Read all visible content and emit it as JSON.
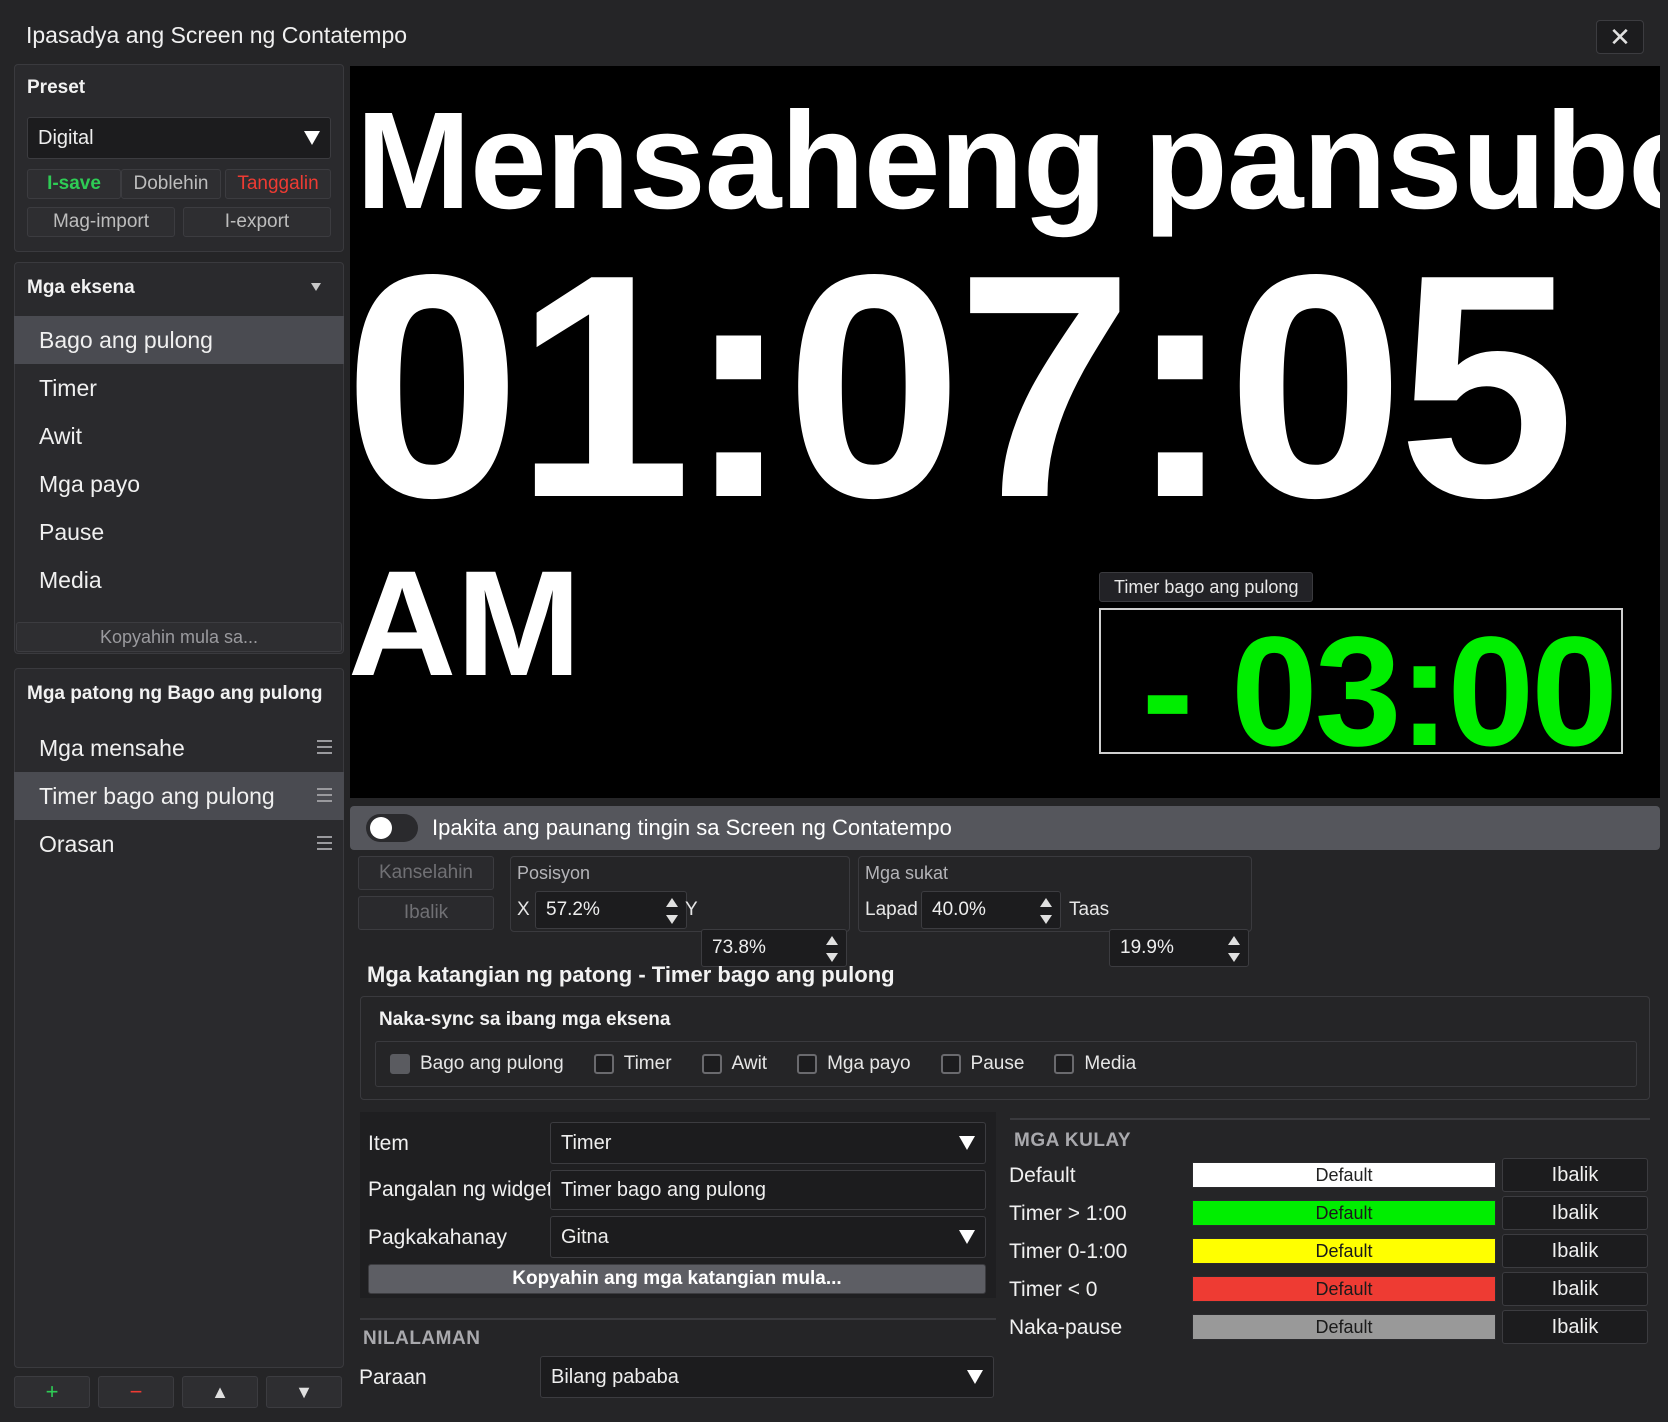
{
  "window": {
    "title": "Ipasadya ang Screen ng Contatempo"
  },
  "preset": {
    "header": "Preset",
    "selected": "Digital",
    "buttons": {
      "save": "I-save",
      "duplicate": "Doblehin",
      "delete": "Tanggalin",
      "import": "Mag-import",
      "export": "I-export"
    }
  },
  "scenes": {
    "header": "Mga eksena",
    "items": [
      "Bago ang pulong",
      "Timer",
      "Awit",
      "Mga payo",
      "Pause",
      "Media"
    ],
    "selected_index": 0,
    "copy_from": "Kopyahin mula sa..."
  },
  "layers": {
    "header": "Mga patong ng Bago ang pulong",
    "items": [
      "Mga mensahe",
      "Timer bago ang pulong",
      "Orasan"
    ],
    "selected_index": 1
  },
  "bottom_toolbar": {
    "add": "+",
    "remove": "−",
    "up": "▲",
    "down": "▼"
  },
  "preview": {
    "message": "Mensaheng pansubok",
    "clock": "01:07:05",
    "ampm": "AM",
    "timer_label": "Timer bago ang pulong",
    "timer_value": "- 03:00",
    "timer_color": "#00ee00"
  },
  "preview_toggle": {
    "label": "Ipakita ang paunang tingin sa Screen ng Contatempo",
    "enabled": false
  },
  "geometry_controls": {
    "cancel": "Kanselahin",
    "reset": "Ibalik",
    "position": {
      "label": "Posisyon",
      "x_label": "X",
      "x_value": "57.2%",
      "y_label": "Y",
      "y_value": "73.8%"
    },
    "size": {
      "label": "Mga sukat",
      "width_label": "Lapad",
      "width_value": "40.0%",
      "height_label": "Taas",
      "height_value": "19.9%"
    }
  },
  "properties": {
    "title": "Mga katangian ng patong - Timer bago ang pulong",
    "sync": {
      "title": "Naka-sync sa ibang mga eksena",
      "scenes": [
        "Bago ang pulong",
        "Timer",
        "Awit",
        "Mga payo",
        "Pause",
        "Media"
      ]
    },
    "item": {
      "label": "Item",
      "value": "Timer"
    },
    "widget_name": {
      "label": "Pangalan ng widget",
      "value": "Timer bago ang pulong"
    },
    "alignment": {
      "label": "Pagkakahanay",
      "value": "Gitna"
    },
    "copy_props": "Kopyahin ang mga katangian mula..."
  },
  "content": {
    "title": "NILALAMAN",
    "mode_label": "Paraan",
    "mode_value": "Bilang pababa"
  },
  "colors": {
    "title": "MGA KULAY",
    "rows": [
      {
        "label": "Default",
        "value": "Default",
        "color": "#ffffff",
        "text_color": "#222222",
        "reset": "Ibalik"
      },
      {
        "label": "Timer > 1:00",
        "value": "Default",
        "color": "#00ee00",
        "text_color": "#1a1a1a",
        "reset": "Ibalik"
      },
      {
        "label": "Timer 0-1:00",
        "value": "Default",
        "color": "#ffff00",
        "text_color": "#1a1a1a",
        "reset": "Ibalik"
      },
      {
        "label": "Timer < 0",
        "value": "Default",
        "color": "#ee3b33",
        "text_color": "#1a1a1a",
        "reset": "Ibalik"
      },
      {
        "label": "Naka-pause",
        "value": "Default",
        "color": "#999999",
        "text_color": "#1a1a1a",
        "reset": "Ibalik"
      }
    ]
  }
}
